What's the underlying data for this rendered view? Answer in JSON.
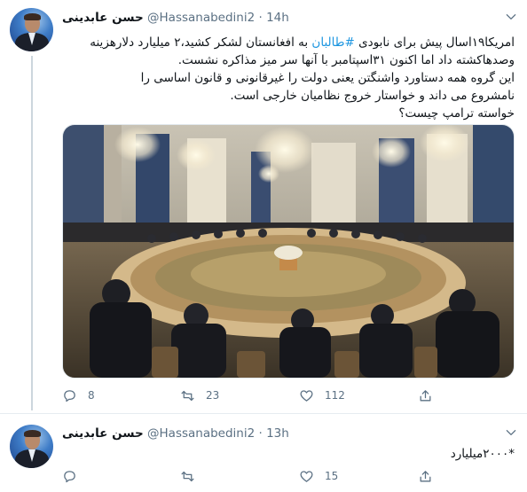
{
  "tweets": [
    {
      "author_name": "حسن عابدینی",
      "handle": "@Hassanabedini2",
      "separator": "·",
      "time": "14h",
      "body_lines": [
        "امریکا۱۹اسال پیش برای نابودی",
        "#طالبان",
        "به افغانستان لشکر کشید،۲ میلیارد دلارهزینه",
        "وصدهاکشته داد اما اکنون ۳۱اسپتامبر با آنها سر میز مذاکره نشست.",
        "این گروه همه دستاورد واشنگتن یعنی دولت را غیرقانونی و قانون اساسی را",
        "نامشروع می داند و خواستار خروج نظامیان خارجی است.",
        "خواسته ترامپ چیست؟"
      ],
      "image_alt": "conference-room-round-table-photo",
      "reply_count": "8",
      "retweet_count": "23",
      "like_count": "112",
      "share_count": ""
    },
    {
      "author_name": "حسن عابدینی",
      "handle": "@Hassanabedini2",
      "separator": "·",
      "time": "13h",
      "body": "*۲۰۰۰میلیارد",
      "reply_count": "",
      "retweet_count": "",
      "like_count": "15",
      "share_count": ""
    }
  ],
  "colors": {
    "text": "#0f1419",
    "secondary": "#5b7083",
    "link": "#1b95e0",
    "divider": "#e6ecf0"
  },
  "icons": [
    "chevron-down-icon",
    "reply-icon",
    "retweet-icon",
    "like-icon",
    "share-icon"
  ]
}
